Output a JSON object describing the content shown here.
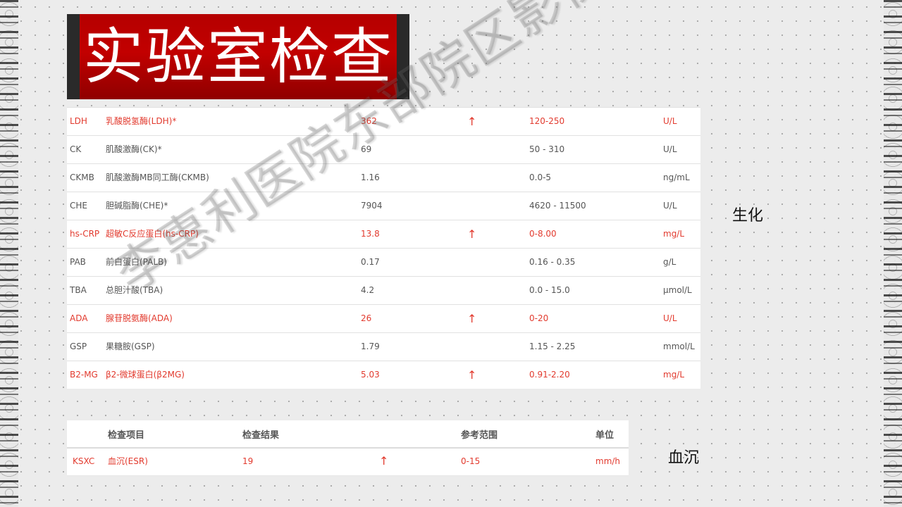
{
  "title": "实验室检查",
  "watermark": "李惠利医院东部院区影像科",
  "biochem": {
    "label": "生化",
    "rows": [
      {
        "code": "LDH",
        "name": "乳酸脱氢酶(LDH)*",
        "result": "362",
        "flag": "↑",
        "range": "120-250",
        "unit": "U/L",
        "abnormal": true
      },
      {
        "code": "CK",
        "name": "肌酸激酶(CK)*",
        "result": "69",
        "flag": "",
        "range": "50 - 310",
        "unit": "U/L",
        "abnormal": false
      },
      {
        "code": "CKMB",
        "name": "肌酸激酶MB同工酶(CKMB)",
        "result": "1.16",
        "flag": "",
        "range": "0.0-5",
        "unit": "ng/mL",
        "abnormal": false
      },
      {
        "code": "CHE",
        "name": "胆碱脂酶(CHE)*",
        "result": "7904",
        "flag": "",
        "range": "4620 - 11500",
        "unit": "U/L",
        "abnormal": false
      },
      {
        "code": "hs-CRP",
        "name": "超敏C反应蛋白(hs-CRP)",
        "result": "13.8",
        "flag": "↑",
        "range": "0-8.00",
        "unit": "mg/L",
        "abnormal": true
      },
      {
        "code": "PAB",
        "name": "前白蛋白(PALB)",
        "result": "0.17",
        "flag": "",
        "range": "0.16 - 0.35",
        "unit": "g/L",
        "abnormal": false
      },
      {
        "code": "TBA",
        "name": "总胆汁酸(TBA)",
        "result": "4.2",
        "flag": "",
        "range": "0.0 - 15.0",
        "unit": "μmol/L",
        "abnormal": false
      },
      {
        "code": "ADA",
        "name": "腺苷脱氨酶(ADA)",
        "result": "26",
        "flag": "↑",
        "range": "0-20",
        "unit": "U/L",
        "abnormal": true
      },
      {
        "code": "GSP",
        "name": "果糖胺(GSP)",
        "result": "1.79",
        "flag": "",
        "range": "1.15 - 2.25",
        "unit": "mmol/L",
        "abnormal": false
      },
      {
        "code": "B2-MG",
        "name": "β2-微球蛋白(β2MG)",
        "result": "5.03",
        "flag": "↑",
        "range": "0.91-2.20",
        "unit": "mg/L",
        "abnormal": true
      }
    ]
  },
  "esr": {
    "label": "血沉",
    "headers": {
      "code": "",
      "item": "检查项目",
      "result": "检查结果",
      "flag": "",
      "range": "参考范围",
      "unit": "单位"
    },
    "rows": [
      {
        "code": "KSXC",
        "item": "血沉(ESR)",
        "result": "19",
        "flag": "↑",
        "range": "0-15",
        "unit": "mm/h"
      }
    ]
  },
  "colors": {
    "abnormal": "#e23a2e",
    "normal": "#555555",
    "banner": "#c20000"
  }
}
